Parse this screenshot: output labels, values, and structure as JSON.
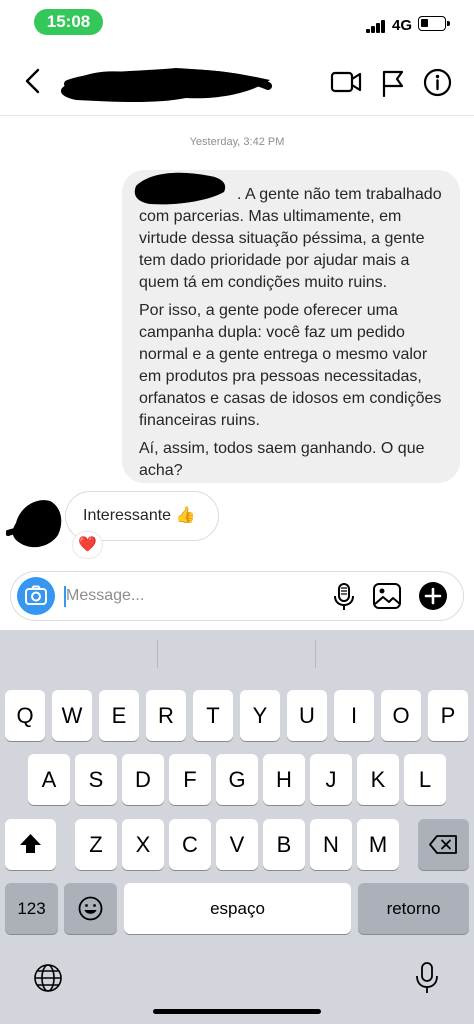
{
  "status_bar": {
    "time": "15:08",
    "network": "4G",
    "battery_level": 0.25,
    "time_pill_color": "#34c759"
  },
  "header": {
    "back_icon": "chevron-left-icon",
    "video_icon": "video-camera-icon",
    "flag_icon": "flag-icon",
    "info_icon": "info-icon"
  },
  "chat": {
    "timestamp": "Yesterday, 3:42 PM",
    "outgoing_message": {
      "paragraph_1": ". A gente não tem trabalhado com parcerias. Mas ultimamente, em virtude dessa situação péssima, a gente tem dado prioridade por ajudar mais a quem tá em condições muito ruins.",
      "paragraph_2": "Por isso, a gente pode oferecer uma campanha dupla: você faz um pedido normal e a gente entrega o mesmo valor em produtos pra pessoas necessitadas, orfanatos e casas de idosos em condições financeiras ruins.",
      "paragraph_3": "Aí, assim, todos saem ganhando. O que acha?"
    },
    "incoming_message": {
      "text": "Interessante 👍",
      "reaction": "❤️"
    }
  },
  "composer": {
    "placeholder": "Message...",
    "accent_color": "#3797f0"
  },
  "keyboard": {
    "row1": [
      "Q",
      "W",
      "E",
      "R",
      "T",
      "Y",
      "U",
      "I",
      "O",
      "P"
    ],
    "row2": [
      "A",
      "S",
      "D",
      "F",
      "G",
      "H",
      "J",
      "K",
      "L"
    ],
    "row3": [
      "Z",
      "X",
      "C",
      "V",
      "B",
      "N",
      "M"
    ],
    "numbers_key": "123",
    "space_key": "espaço",
    "return_key": "retorno"
  }
}
